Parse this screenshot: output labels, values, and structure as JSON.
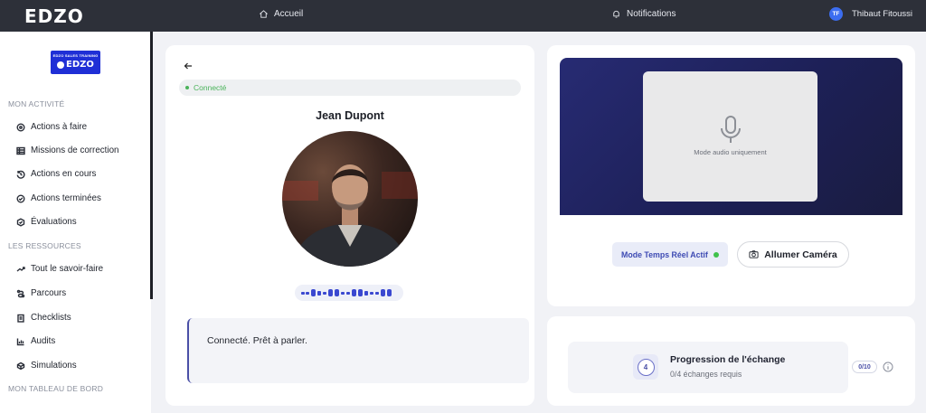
{
  "topbar": {
    "brand": "EDZO",
    "nav_home": "Accueil",
    "nav_notifications": "Notifications",
    "user_initials": "TF",
    "user_name": "Thibaut Fitoussi"
  },
  "sidebar": {
    "logo_small": "EDZO SALES TRAINING",
    "logo_main": "EDZO",
    "section_activity": "MON ACTIVITÉ",
    "activity_items": [
      {
        "label": "Actions à faire",
        "icon": "target-icon"
      },
      {
        "label": "Missions de correction",
        "icon": "table-icon"
      },
      {
        "label": "Actions en cours",
        "icon": "history-icon"
      },
      {
        "label": "Actions terminées",
        "icon": "check-circle-icon"
      },
      {
        "label": "Évaluations",
        "icon": "evaluation-icon"
      }
    ],
    "section_resources": "LES RESSOURCES",
    "resource_items": [
      {
        "label": "Tout le savoir-faire",
        "icon": "layers-icon"
      },
      {
        "label": "Parcours",
        "icon": "route-icon"
      },
      {
        "label": "Checklists",
        "icon": "checklist-icon"
      },
      {
        "label": "Audits",
        "icon": "chart-icon"
      },
      {
        "label": "Simulations",
        "icon": "simulation-icon"
      }
    ],
    "section_dashboard": "MON TABLEAU DE BORD"
  },
  "call": {
    "status": "Connecté",
    "person_name": "Jean Dupont",
    "message": "Connecté. Prêt à parler."
  },
  "video": {
    "audio_label": "Mode audio uniquement",
    "mode_badge": "Mode Temps Réel Actif",
    "camera_button": "Allumer Caméra"
  },
  "progress": {
    "step": "4",
    "title": "Progression de l'échange",
    "subtitle": "0/4 échanges requis",
    "count": "0/10"
  },
  "colors": {
    "topbar": "#2d3039",
    "accent": "#4a4fa6",
    "status_green": "#4ab35a",
    "video_bg": "#1d2057"
  }
}
